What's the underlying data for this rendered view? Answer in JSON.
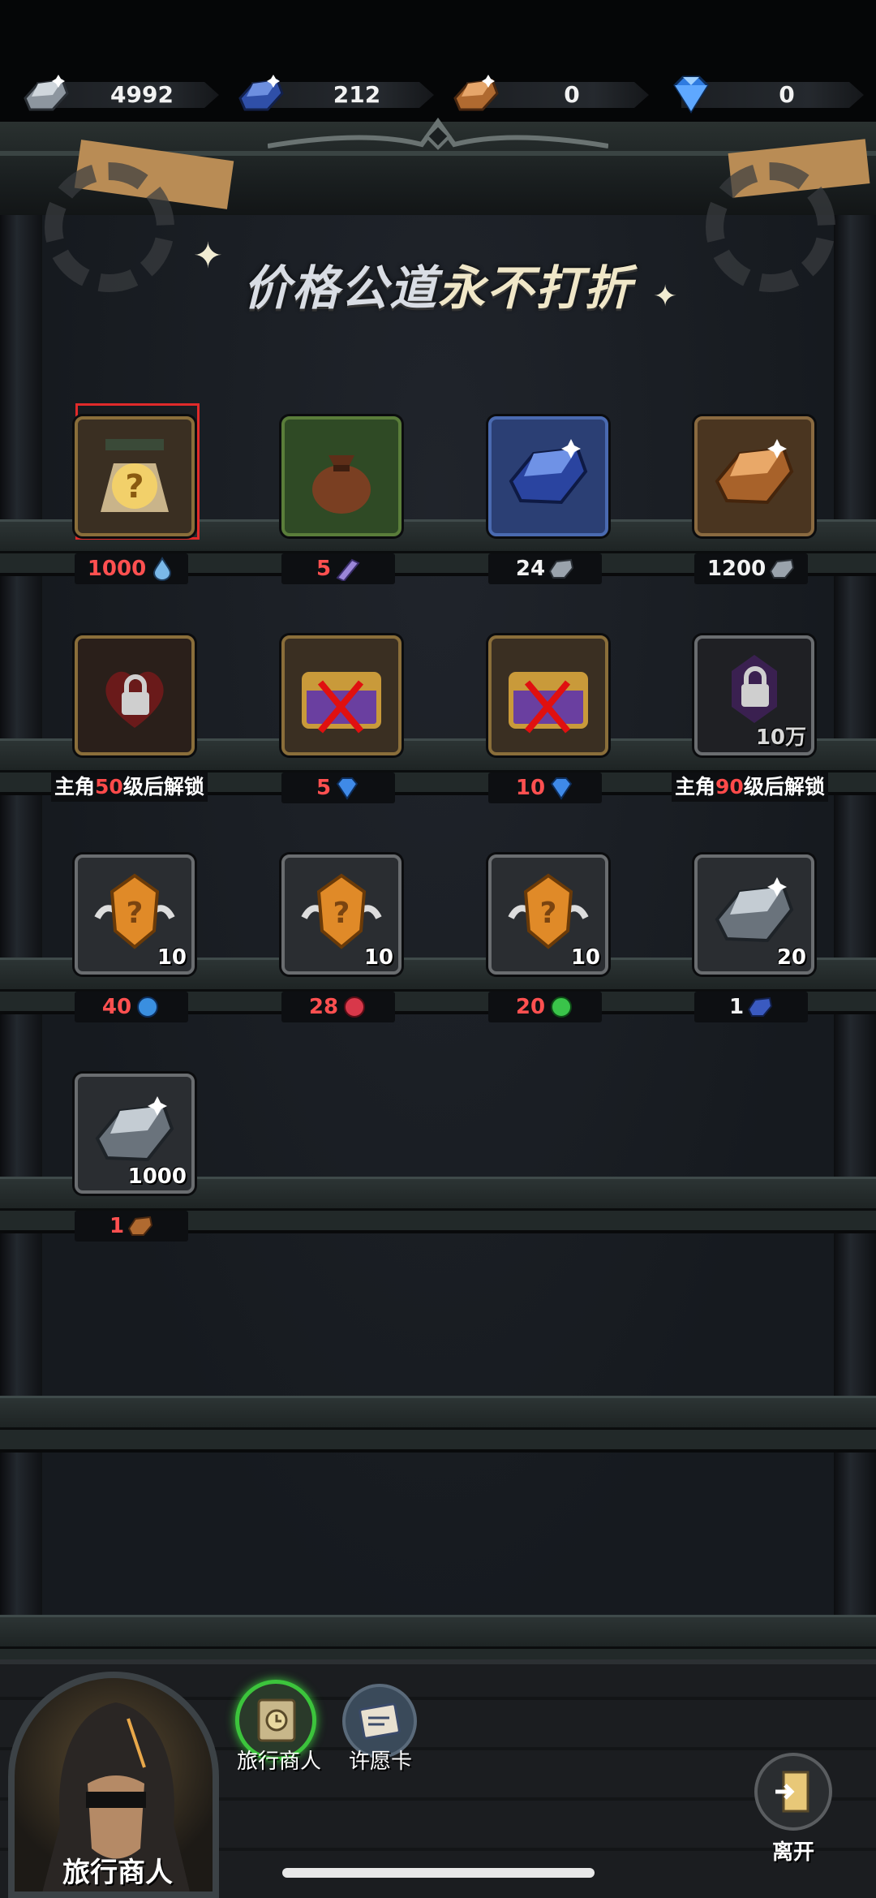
{
  "currencies": [
    {
      "icon": "silver-crystal-icon",
      "value": "4992"
    },
    {
      "icon": "blue-crystal-icon",
      "value": "212"
    },
    {
      "icon": "bronze-crystal-icon",
      "value": "0"
    },
    {
      "icon": "diamond-icon",
      "value": "0"
    }
  ],
  "banner": {
    "part1": "价格公道",
    "part2": "永不打折"
  },
  "items": [
    {
      "name": "mystery-relic-item",
      "qty": "",
      "price": "1000",
      "currency": "water-drop-icon"
    },
    {
      "name": "loot-bag-item",
      "qty": "",
      "price": "5",
      "currency": "purple-scroll-icon"
    },
    {
      "name": "blue-crystal-item",
      "qty": "",
      "price": "24",
      "currency": "silver-crystal-icon"
    },
    {
      "name": "bronze-crystal-item",
      "qty": "",
      "price": "1200",
      "currency": "silver-crystal-icon"
    },
    {
      "name": "locked-heart-item",
      "qty": "",
      "lock": {
        "pre": "主角",
        "level": "50",
        "post": "级后解锁"
      }
    },
    {
      "name": "treasure-chest-item",
      "qty": "",
      "price": "5",
      "currency": "diamond-icon",
      "crossed": true
    },
    {
      "name": "treasure-chest-item",
      "qty": "",
      "price": "10",
      "currency": "diamond-icon",
      "crossed": true
    },
    {
      "name": "locked-purple-gem-item",
      "qty": "10万",
      "lock": {
        "pre": "主角",
        "level": "90",
        "post": "级后解锁"
      }
    },
    {
      "name": "mystery-orange-gem-item",
      "qty": "10",
      "price": "40",
      "currency": "blue-orb-icon"
    },
    {
      "name": "mystery-orange-gem-item",
      "qty": "10",
      "price": "28",
      "currency": "red-orb-icon"
    },
    {
      "name": "mystery-orange-gem-item",
      "qty": "10",
      "price": "20",
      "currency": "green-orb-icon"
    },
    {
      "name": "silver-crystal-item",
      "qty": "20",
      "price": "1",
      "currency": "blue-crystal-icon",
      "white": true
    },
    {
      "name": "silver-crystal-item",
      "qty": "1000",
      "price": "1",
      "currency": "bronze-crystal-icon"
    }
  ],
  "merchant": {
    "name": "旅行商人"
  },
  "tabs": [
    {
      "label": "旅行商人",
      "icon": "scroll-clock-icon",
      "active": true
    },
    {
      "label": "许愿卡",
      "icon": "wish-card-icon",
      "active": false
    }
  ],
  "exit": {
    "label": "离开",
    "icon": "exit-door-icon"
  },
  "colors": {
    "price_red": "#ff5050",
    "highlight": "#e02a2a",
    "active_tab": "#3cc43c"
  }
}
